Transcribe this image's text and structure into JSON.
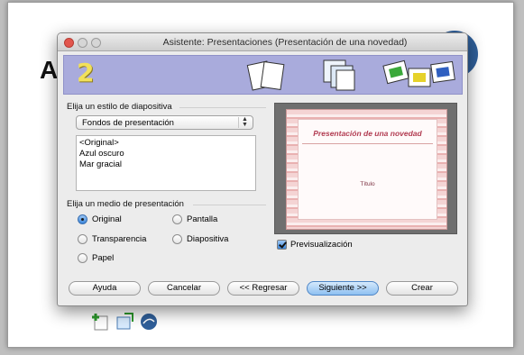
{
  "background": {
    "letter": "A"
  },
  "dialog": {
    "title": "Asistente: Presentaciones (Presentación de una novedad)",
    "step": "2",
    "style_section_label": "Elija un estilo de diapositiva",
    "style_select_value": "Fondos de presentación",
    "style_list": [
      "<Original>",
      "Azul oscuro",
      "Mar gracial"
    ],
    "medium_section_label": "Elija un medio de presentación",
    "media": [
      {
        "label": "Original",
        "selected": true
      },
      {
        "label": "Pantalla",
        "selected": false
      },
      {
        "label": "Transparencia",
        "selected": false
      },
      {
        "label": "Diapositiva",
        "selected": false
      },
      {
        "label": "Papel",
        "selected": false
      }
    ],
    "preview": {
      "slide_title": "Presentación de una novedad",
      "slide_subtitle": "Título"
    },
    "preview_checkbox_label": "Previsualización",
    "preview_checked": true,
    "buttons": {
      "help": "Ayuda",
      "cancel": "Cancelar",
      "back": "<< Regresar",
      "next": "Siguiente >>",
      "create": "Crear"
    },
    "colors": {
      "banner": "#a9abdc",
      "step_number": "#f2e15a",
      "primary_button": "#8ec0f1",
      "slide_title": "#b23c52"
    }
  }
}
